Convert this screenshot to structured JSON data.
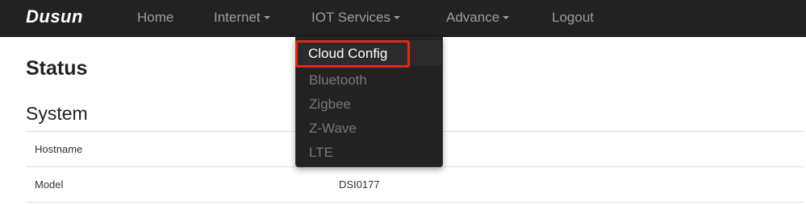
{
  "navbar": {
    "brand": "Dusun",
    "items": [
      {
        "label": "Home",
        "dropdown": false
      },
      {
        "label": "Internet",
        "dropdown": true
      },
      {
        "label": "IOT Services",
        "dropdown": true
      },
      {
        "label": "Advance",
        "dropdown": true
      },
      {
        "label": "Logout",
        "dropdown": false
      }
    ]
  },
  "dropdown": {
    "parent": "IOT Services",
    "items": [
      {
        "label": "Cloud Config",
        "highlighted": true
      },
      {
        "label": "Bluetooth"
      },
      {
        "label": "Zigbee"
      },
      {
        "label": "Z-Wave"
      },
      {
        "label": "LTE"
      }
    ]
  },
  "page": {
    "title": "Status",
    "section": "System",
    "table": {
      "rows": [
        {
          "label": "Hostname",
          "value": ""
        },
        {
          "label": "Model",
          "value": "DSI0177"
        }
      ]
    }
  },
  "colors": {
    "navbar_bg": "#222222",
    "nav_text": "#9d9d9d",
    "highlight_border": "#e0281e",
    "dropdown_text": "#777777"
  }
}
